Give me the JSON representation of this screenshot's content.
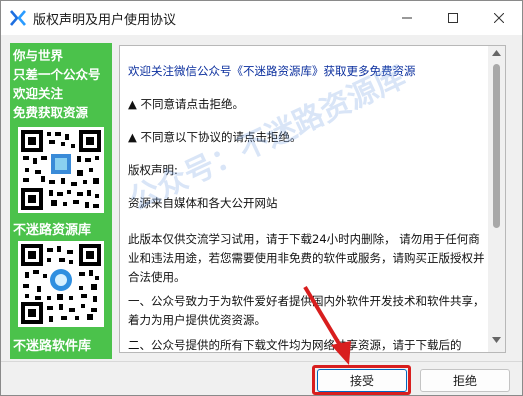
{
  "window": {
    "title": "版权声明及用户使用协议",
    "app_icon": "x-logo-icon",
    "controls": {
      "minimize": "minimize-icon",
      "maximize": "maximize-icon",
      "close": "close-icon"
    }
  },
  "sidebar": {
    "promo_lines": [
      "你与世界",
      "只差一个公众号",
      "欢迎关注",
      "免费获取资源"
    ],
    "qr_labels": [
      "不迷路资源库",
      "不迷路软件库"
    ]
  },
  "content": {
    "paragraphs": [
      "欢迎关注微信公众号《不迷路资源库》获取更多免费资源",
      "▲ 不同意请点击拒绝。",
      "▲ 不同意以下协议的请点击拒绝。",
      "版权声明:",
      "资源来自媒体和各大公开网站",
      "此版本仅供交流学习试用，请于下载24小时内删除， 请勿用于任何商业和违法用途，若您需要使用非免费的软件或服务，请购买正版授权并合法使用。",
      "一、公众号致力于为软件爱好者提供国内外软件开发技术和软件共享，着力为用户提供优资资源。",
      "二、公众号提供的所有下载文件均为网络共享资源，请于下载后的"
    ]
  },
  "watermark": "公众号：不迷路资源库",
  "buttons": {
    "accept": "接受",
    "reject": "拒绝"
  },
  "colors": {
    "sidebar_green": "#4bc24b",
    "link_blue": "#0b2f9e",
    "highlight_red": "#d81e1e",
    "accent_blue": "#0067c0"
  }
}
